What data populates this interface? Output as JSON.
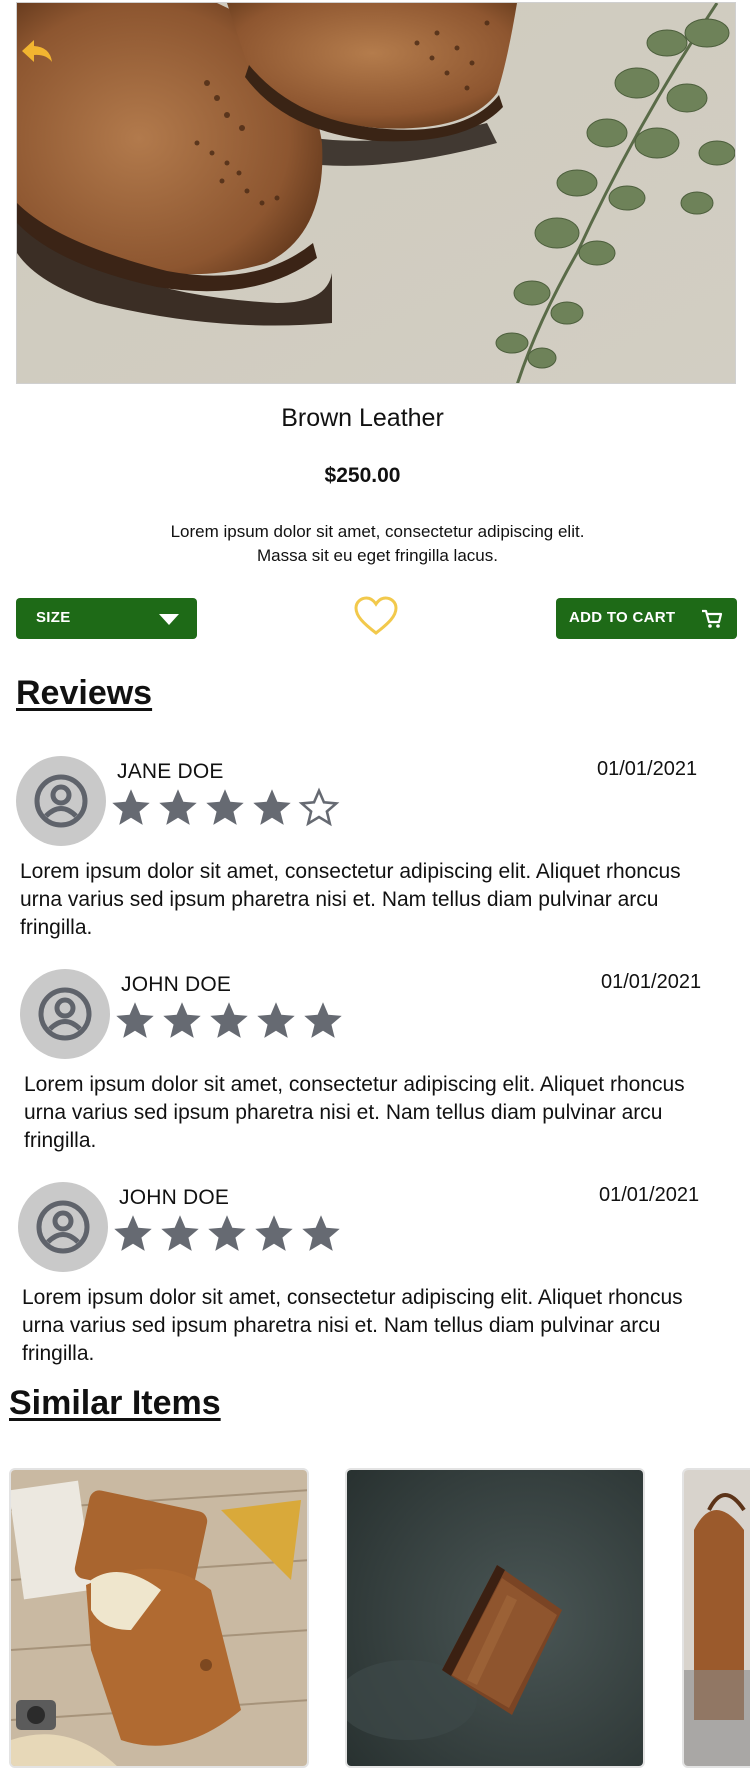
{
  "product": {
    "name": "Brown Leather",
    "price": "$250.00",
    "description_line1": "Lorem ipsum dolor sit amet, consectetur adipiscing elit.",
    "description_line2": "Massa sit eu eget fringilla lacus."
  },
  "actions": {
    "size_label": "SIZE",
    "add_to_cart_label": "ADD TO CART"
  },
  "reviews_title": "Reviews",
  "reviews": [
    {
      "name": "JANE DOE",
      "date": "01/01/2021",
      "rating": 4,
      "max_rating": 5,
      "text": "Lorem ipsum dolor sit amet, consectetur adipiscing elit. Aliquet rhoncus urna varius sed ipsum pharetra nisi et. Nam tellus diam pulvinar arcu fringilla."
    },
    {
      "name": "JOHN DOE",
      "date": "01/01/2021",
      "rating": 5,
      "max_rating": 5,
      "text": "Lorem ipsum dolor sit amet, consectetur adipiscing elit. Aliquet rhoncus urna varius sed ipsum pharetra nisi et. Nam tellus diam pulvinar arcu fringilla."
    },
    {
      "name": "JOHN DOE",
      "date": "01/01/2021",
      "rating": 5,
      "max_rating": 5,
      "text": "Lorem ipsum dolor sit amet, consectetur adipiscing elit. Aliquet rhoncus urna varius sed ipsum pharetra nisi et. Nam tellus diam pulvinar arcu fringilla."
    }
  ],
  "similar_title": "Similar Items",
  "colors": {
    "accent_green": "#1e6a17",
    "back_arrow": "#f2b530",
    "heart_outline": "#f2c94c",
    "star": "#666a72",
    "avatar_bg": "#c9c9c9"
  },
  "icons": {
    "back": "back-arrow-icon",
    "size_dropdown": "caret-down-icon",
    "favorite": "heart-outline-icon",
    "cart": "cart-icon",
    "avatar": "user-circle-icon",
    "star": "star-icon"
  }
}
